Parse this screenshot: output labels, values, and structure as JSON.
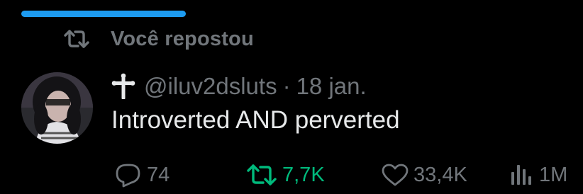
{
  "banner": {
    "text": "Você repostou"
  },
  "progress": {
    "fraction": 0.28
  },
  "post": {
    "handle": "@iluv2dsluts",
    "separator": "·",
    "date": "18 jan.",
    "text": "Introverted AND perverted"
  },
  "actions": {
    "replies": "74",
    "reposts": "7,7K",
    "likes": "33,4K",
    "views": "1M"
  },
  "colors": {
    "accent_blue": "#1d9bf0",
    "repost_green": "#00ba7c",
    "muted_text": "#71767b",
    "primary_text": "#e7e9ea",
    "background": "#000000"
  },
  "icons": [
    "repost-icon",
    "cross-icon",
    "reply-icon",
    "repost-icon",
    "like-icon",
    "views-icon"
  ]
}
